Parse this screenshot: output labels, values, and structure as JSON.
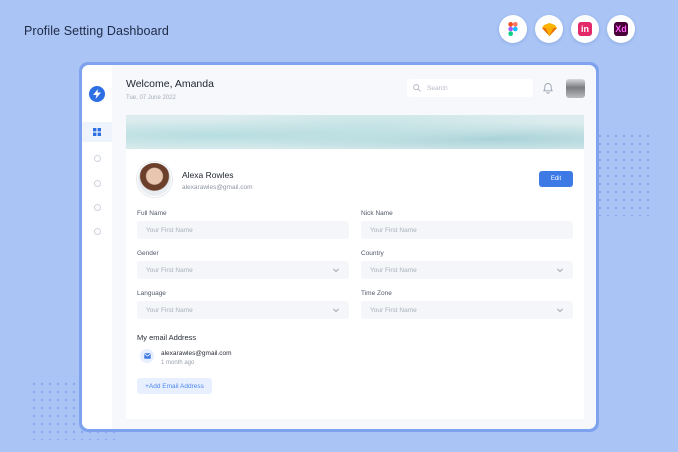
{
  "promo": {
    "title": "Profile Setting Dashboard",
    "tools": [
      {
        "name": "figma-icon",
        "color": "#f24e1e"
      },
      {
        "name": "sketch-icon",
        "color": "#f7b500"
      },
      {
        "name": "invision-icon",
        "color": "#e3286a",
        "glyph": "in"
      },
      {
        "name": "adobe-xd-icon",
        "color": "#470137",
        "glyph": "Xd"
      }
    ]
  },
  "colors": {
    "background": "#a9c4f5",
    "accent": "#3d7ae6",
    "frame": "#7ea2ee"
  },
  "header": {
    "welcome": "Welcome, Amanda",
    "date": "Tue, 07 June 2022",
    "search_placeholder": "Search"
  },
  "sidebar": {
    "items": [
      {
        "icon": "dashboard-icon",
        "active": true
      },
      {
        "icon": "circle-icon",
        "active": false
      },
      {
        "icon": "circle-icon",
        "active": false
      },
      {
        "icon": "circle-icon",
        "active": false
      },
      {
        "icon": "circle-icon",
        "active": false
      }
    ]
  },
  "profile": {
    "name": "Alexa Rowles",
    "email": "alexarawles@gmail.com",
    "edit_label": "Edit"
  },
  "form": {
    "full_name": {
      "label": "Full Name",
      "placeholder": "Your First Name"
    },
    "nick_name": {
      "label": "Nick Name",
      "placeholder": "Your First Name"
    },
    "gender": {
      "label": "Gender",
      "value": "Your First Name"
    },
    "country": {
      "label": "Country",
      "value": "Your First Name"
    },
    "language": {
      "label": "Language",
      "value": "Your First Name"
    },
    "time_zone": {
      "label": "Time Zone",
      "value": "Your First Name"
    }
  },
  "emails": {
    "heading": "My email Address",
    "items": [
      {
        "address": "alexarawles@gmail.com",
        "age": "1 month ago"
      }
    ],
    "add_label": "+Add Email Address"
  }
}
